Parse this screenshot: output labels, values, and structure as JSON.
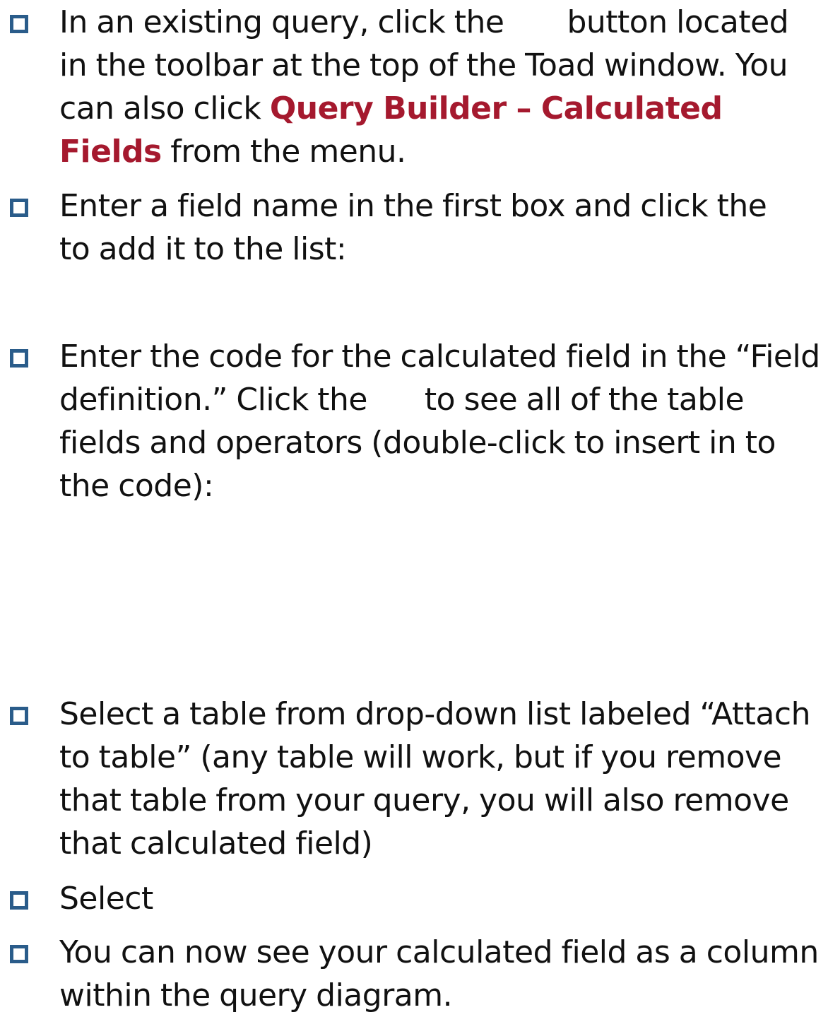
{
  "items": [
    {
      "segments": [
        "In an existing query, click the",
        "button located in the toolbar at the top of the Toad window. You can also click",
        "Query Builder – Calculated Fields",
        "from the menu."
      ]
    },
    {
      "segments": [
        "Enter a field name in the first box and click the",
        "to add it to the list:"
      ]
    },
    {
      "segments": [
        "Enter the code for the calculated field in the “Field definition.” Click the",
        "to see all of the table fields and operators (double-click to insert in to the code):"
      ]
    },
    {
      "segments": [
        "Select a table from drop-down list labeled “Attach to table” (any table will work, but if you remove that table from your query, you will also remove that calculated field)"
      ]
    },
    {
      "segments": [
        "Select"
      ]
    },
    {
      "segments": [
        "You can now see your calculated field as a column within the query diagram."
      ]
    }
  ],
  "colors": {
    "bullet": "#2a5c8a",
    "highlight": "#a5192e",
    "text": "#111111"
  }
}
